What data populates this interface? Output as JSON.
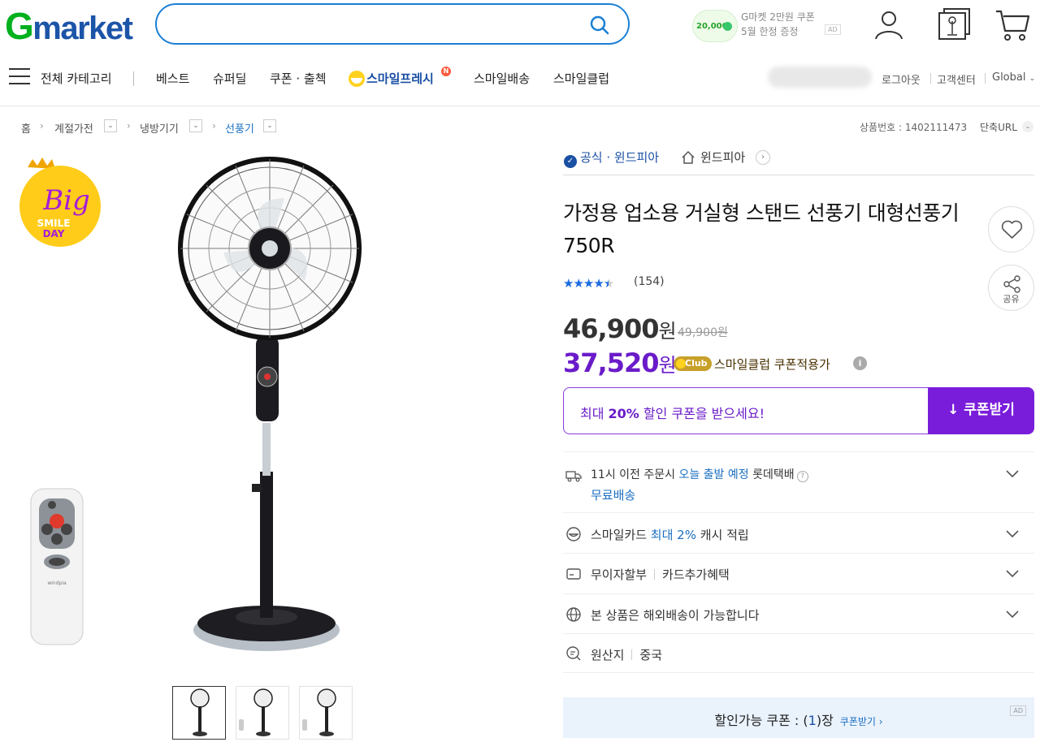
{
  "header": {
    "logo_g": "G",
    "logo_rest": "market",
    "search_placeholder": "",
    "ad": {
      "coin": "20,000",
      "line1": "G마켓 2만원 쿠폰",
      "line2": "5월 한정 증정",
      "tag": "AD"
    }
  },
  "nav": {
    "all_categories": "전체 카테고리",
    "items": [
      "베스트",
      "슈퍼딜",
      "쿠폰 · 출첵",
      "스마일프레시",
      "스마일배송",
      "스마일클럽"
    ],
    "fresh_badge": "N",
    "util": [
      "로그아웃",
      "고객센터",
      "Global"
    ]
  },
  "breadcrumb": {
    "items": [
      "홈",
      "계절가전",
      "냉방기기",
      "선풍기"
    ],
    "product_no_label": "상품번호 : 1402111473",
    "short_url": "단축URL"
  },
  "badge": {
    "line1": "Big",
    "line2": "SMILE",
    "line3": "DAY"
  },
  "seller": {
    "official": "공식 · 윈드피아",
    "shop": "윈드피아"
  },
  "product": {
    "title": "가정용 업소용 거실형 스탠드 선풍기 대형선풍기 750R",
    "rating": 4.5,
    "review_count": "(154)",
    "price": "46,900",
    "won": "원",
    "original_price": "49,900원",
    "club_price": "37,520",
    "club_badge": "Club",
    "club_text": "스마일클럽 쿠폰적용가",
    "share_label": "공유"
  },
  "coupon": {
    "msg_pre": "최대 ",
    "msg_bold": "20%",
    "msg_post": " 할인 쿠폰을 받으세요!",
    "button": "쿠폰받기"
  },
  "rows": {
    "delivery_pre": "11시 이전 주문시 ",
    "delivery_blue": "오늘 출발 예정",
    "delivery_post": " 롯데택배",
    "delivery_free": "무료배송",
    "card_pre": "스마일카드 ",
    "card_blue": "최대 2%",
    "card_post": " 캐시 적립",
    "installment": "무이자할부",
    "card_benefit": "카드추가혜택",
    "overseas": "본 상품은 해외배송이 가능합니다",
    "origin_label": "원산지",
    "origin_value": "중국"
  },
  "available_coupon": {
    "pre": "할인가능 쿠폰 : (",
    "n": "1",
    "post": ")장",
    "link": "쿠폰받기 ›",
    "tag": "AD"
  },
  "colors": {
    "accent_purple": "#7a1ddb",
    "brand_blue": "#1c55a8",
    "brand_green": "#00b11e"
  }
}
